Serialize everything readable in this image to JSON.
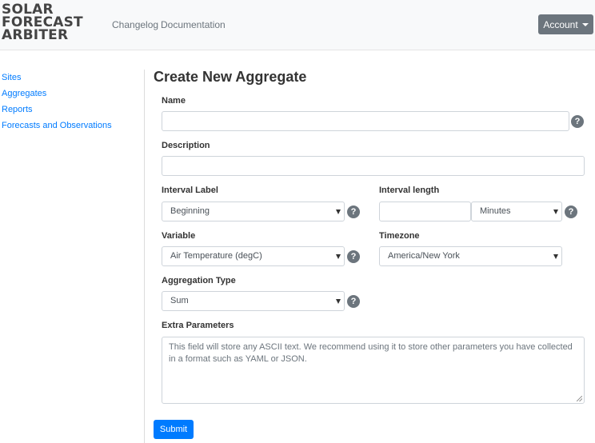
{
  "brand": {
    "line1": "SOLAR",
    "line2": "FORECAST",
    "line3": "ARBITER"
  },
  "nav": {
    "changelog": "Changelog",
    "documentation": "Documentation",
    "account": "Account"
  },
  "sidebar": {
    "items": [
      {
        "label": "Sites"
      },
      {
        "label": "Aggregates"
      },
      {
        "label": "Reports"
      },
      {
        "label": "Forecasts and Observations"
      }
    ]
  },
  "form": {
    "title": "Create New Aggregate",
    "name_label": "Name",
    "name_value": "",
    "description_label": "Description",
    "description_value": "",
    "interval_label_label": "Interval Label",
    "interval_label_value": "Beginning",
    "interval_length_label": "Interval length",
    "interval_length_value": "",
    "interval_length_unit": "Minutes",
    "variable_label": "Variable",
    "variable_value": "Air Temperature (degC)",
    "timezone_label": "Timezone",
    "timezone_value": "America/New York",
    "aggregation_type_label": "Aggregation Type",
    "aggregation_type_value": "Sum",
    "extra_parameters_label": "Extra Parameters",
    "extra_parameters_placeholder": "This field will store any ASCII text. We recommend using it to store other parameters you have collected in a format such as YAML or JSON.",
    "help_glyph": "?",
    "submit_label": "Submit"
  }
}
